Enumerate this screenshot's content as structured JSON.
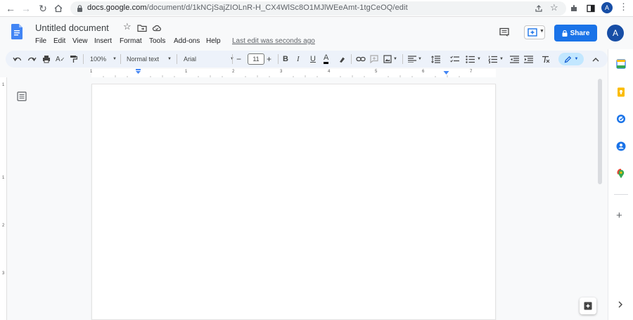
{
  "browser": {
    "url_host": "docs.google.com",
    "url_path": "/document/d/1kNCjSajZIOLnR-H_CX4WlSc8O1MJlWEeAmt-1tgCeOQ/edit",
    "profile_initial": "A"
  },
  "doc": {
    "title": "Untitled document",
    "last_edit": "Last edit was seconds ago",
    "share_label": "Share",
    "avatar_initial": "A"
  },
  "menu": [
    "File",
    "Edit",
    "View",
    "Insert",
    "Format",
    "Tools",
    "Add-ons",
    "Help"
  ],
  "toolbar": {
    "zoom": "100%",
    "style": "Normal text",
    "font": "Arial",
    "font_size": "11",
    "bold": "B",
    "italic": "I",
    "underline": "U",
    "text_color": "A"
  },
  "ruler": {
    "numbers": [
      "1",
      "1",
      "2",
      "3",
      "4",
      "5",
      "6",
      "7"
    ]
  },
  "left_ruler": {
    "numbers": [
      "1",
      "1",
      "2",
      "3"
    ]
  },
  "colors": {
    "accent": "#1a73e8",
    "toolbar_bg": "#edf2fa",
    "page_bg": "#f8f9fa"
  }
}
